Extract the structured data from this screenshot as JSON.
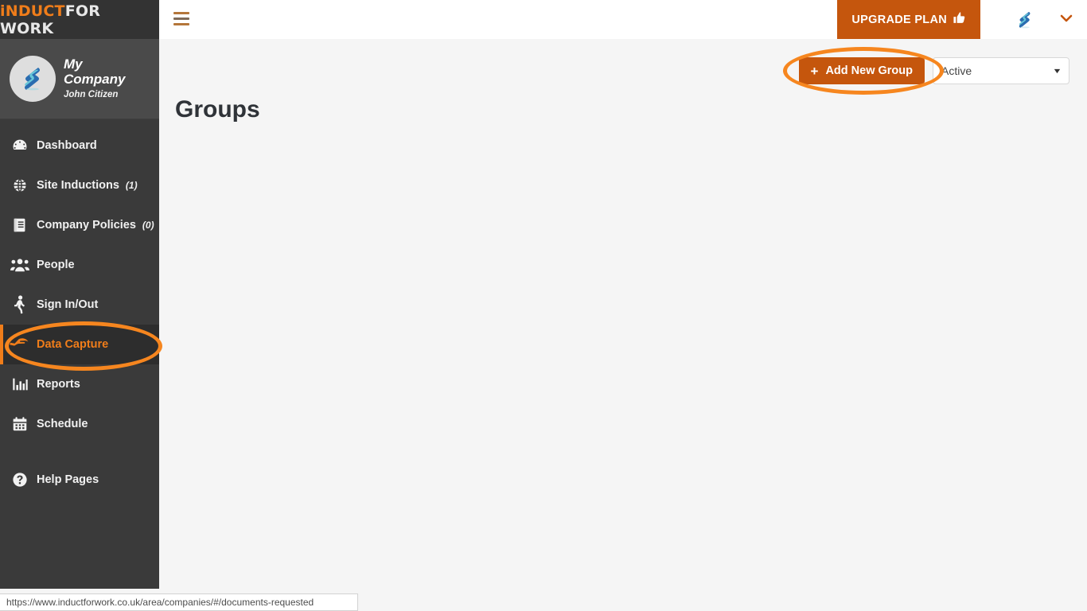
{
  "brand": {
    "logo_prefix": "iNDUCT",
    "logo_suffix": "FOR WORK",
    "accent_color": "#f07d1a",
    "button_color": "#c5560d",
    "annotation_color": "#f6861f",
    "logo_icon": "induct-logo-icon"
  },
  "sidebar": {
    "company_name": "My Company",
    "company_user": "John Citizen",
    "avatar_icon": "induct-logo-avatar-icon",
    "items": [
      {
        "label": "Dashboard",
        "icon": "gauge-icon",
        "count": "",
        "active": false
      },
      {
        "label": "Site Inductions",
        "icon": "globe-icon",
        "count": "(1)",
        "active": false
      },
      {
        "label": "Company Policies",
        "icon": "book-icon",
        "count": "(0)",
        "active": false
      },
      {
        "label": "People",
        "icon": "people-icon",
        "count": "",
        "active": false
      },
      {
        "label": "Sign In/Out",
        "icon": "walking-icon",
        "count": "",
        "active": false
      },
      {
        "label": "Data Capture",
        "icon": "hand-receive-icon",
        "count": "",
        "active": true
      },
      {
        "label": "Reports",
        "icon": "bar-chart-icon",
        "count": "",
        "active": false
      },
      {
        "label": "Schedule",
        "icon": "calendar-icon",
        "count": "",
        "active": false
      },
      {
        "label": "Help Pages",
        "icon": "question-circle-icon",
        "count": "",
        "active": false
      }
    ]
  },
  "topbar": {
    "menu_icon": "hamburger-icon",
    "upgrade_label": "UPGRADE PLAN",
    "upgrade_icon": "thumbs-up-icon",
    "account_logo_icon": "induct-logo-icon",
    "account_caret_icon": "chevron-down-icon"
  },
  "main": {
    "page_title": "Groups",
    "add_button_label": "Add New Group",
    "add_button_icon": "plus-icon",
    "status_filter_value": "Active",
    "status_filter_caret_icon": "caret-down-icon",
    "status_filter_options": [
      "Active"
    ]
  },
  "annotations": [
    {
      "name": "add-new-group-highlight",
      "shape": "ellipse"
    },
    {
      "name": "data-capture-highlight",
      "shape": "ellipse"
    }
  ],
  "statusbar": {
    "url": "https://www.inductforwork.co.uk/area/companies/#/documents-requested"
  }
}
